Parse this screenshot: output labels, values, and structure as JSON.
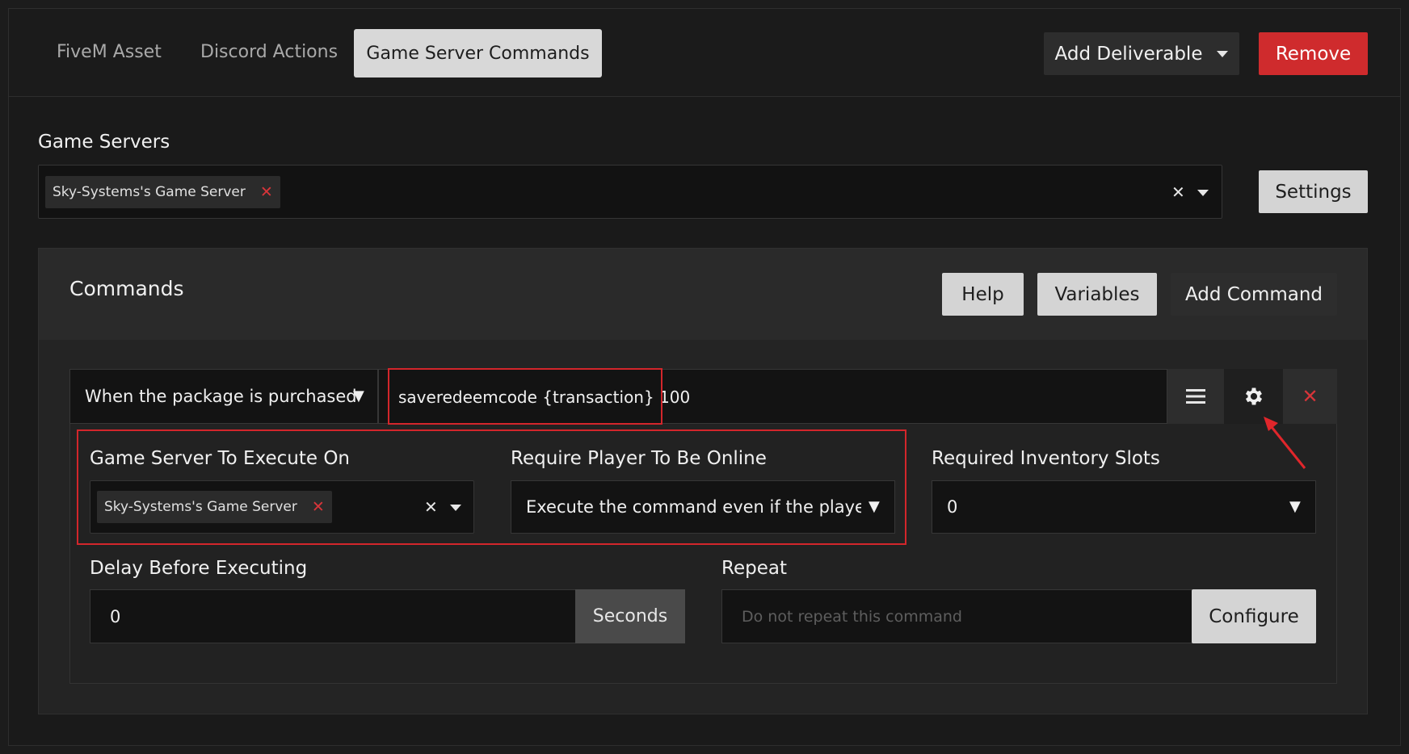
{
  "tabs": [
    {
      "label": "FiveM Asset"
    },
    {
      "label": "Discord Actions"
    },
    {
      "label": "Game Server Commands"
    }
  ],
  "header_buttons": {
    "add_deliverable": "Add Deliverable",
    "remove": "Remove"
  },
  "game_servers": {
    "label": "Game Servers",
    "selected": "Sky-Systems's Game Server",
    "settings_button": "Settings"
  },
  "commands": {
    "title": "Commands",
    "help_button": "Help",
    "variables_button": "Variables",
    "add_command_button": "Add Command"
  },
  "command": {
    "trigger": "When the package is purchased",
    "text": "saveredeemcode {transaction} 100",
    "execute_on": {
      "label": "Game Server To Execute On",
      "selected": "Sky-Systems's Game Server"
    },
    "require_online": {
      "label": "Require Player To Be Online",
      "value": "Execute the command even if the player is offl"
    },
    "inventory_slots": {
      "label": "Required Inventory Slots",
      "value": "0"
    },
    "delay": {
      "label": "Delay Before Executing",
      "value": "0",
      "unit": "Seconds"
    },
    "repeat": {
      "label": "Repeat",
      "placeholder": "Do not repeat this command",
      "configure_button": "Configure"
    }
  },
  "colors": {
    "accent_red": "#cf2b2d",
    "highlight_red": "#d3262b"
  }
}
